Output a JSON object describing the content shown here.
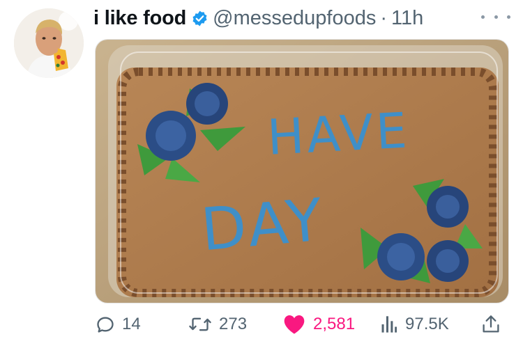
{
  "tweet": {
    "display_name": "i like food",
    "handle": "@messedupfoods",
    "separator": "·",
    "time": "11h",
    "verified": true
  },
  "media": {
    "cake_text_line1": "HAVE",
    "cake_text_line2": "DAY",
    "icing_color": "#3f8fc8",
    "frosting_color": "#a8764a"
  },
  "actions": {
    "replies": "14",
    "retweets": "273",
    "likes": "2,581",
    "views": "97.5K",
    "like_color": "#f91880"
  },
  "icons": [
    "avatar",
    "verified-badge-icon",
    "more-icon",
    "reply-icon",
    "retweet-icon",
    "like-icon",
    "views-icon",
    "share-icon"
  ]
}
